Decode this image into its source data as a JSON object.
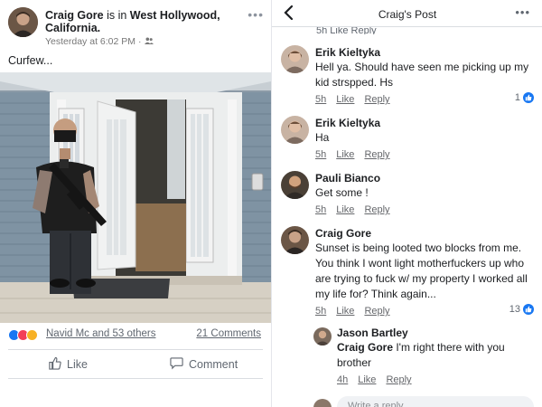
{
  "post": {
    "author": "Craig Gore",
    "is_in": " is in ",
    "location": "West Hollywood, California.",
    "timestamp": "Yesterday at 6:02 PM",
    "privacy_icon": "friends-icon",
    "text": "Curfew...",
    "reactions": {
      "icons": [
        "like",
        "love",
        "haha"
      ],
      "names": "Navid Mc and 53 others",
      "comments": "21 Comments"
    },
    "actions": {
      "like": "Like",
      "comment": "Comment"
    }
  },
  "thread": {
    "title": "Craig's Post",
    "cut_off_text": "5h    Like    Reply",
    "comments": [
      {
        "name": "Erik Kieltyka",
        "text": "Hell ya. Should have seen me picking up my kid strspped. Hs",
        "time": "5h",
        "like": "Like",
        "reply": "Reply",
        "likes": "1"
      },
      {
        "name": "Erik Kieltyka",
        "text": "Ha",
        "time": "5h",
        "like": "Like",
        "reply": "Reply",
        "likes": ""
      },
      {
        "name": "Pauli Bianco",
        "text": "Get some !",
        "time": "5h",
        "like": "Like",
        "reply": "Reply",
        "likes": ""
      },
      {
        "name": "Craig Gore",
        "text": "Sunset is being looted two blocks from me. You think I wont light motherfuckers up who are trying to fuck w/ my property I worked all my life for?  Think again...",
        "time": "5h",
        "like": "Like",
        "reply": "Reply",
        "likes": "13"
      }
    ],
    "reply": {
      "name": "Jason Bartley",
      "mention": "Craig Gore",
      "text": " I'm right there with you brother",
      "time": "4h",
      "like": "Like",
      "reply": "Reply"
    },
    "composer_placeholder": "Write a reply..."
  },
  "colors": {
    "accent": "#1877f2",
    "text": "#1c1e21",
    "muted": "#606770",
    "divider": "#dadde1"
  }
}
